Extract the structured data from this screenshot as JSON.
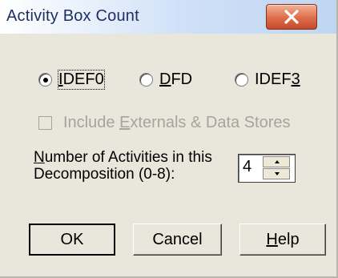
{
  "dialog": {
    "title": "Activity Box Count",
    "close_glyph": "✕"
  },
  "methods": {
    "selected": "IDEF0",
    "options": [
      {
        "pre": "",
        "mnemonic": "I",
        "post": "DEF0"
      },
      {
        "pre": "",
        "mnemonic": "D",
        "post": "FD"
      },
      {
        "pre": "IDEF",
        "mnemonic": "3",
        "post": ""
      }
    ]
  },
  "include_externals": {
    "pre": "Include ",
    "mnemonic": "E",
    "post": "xternals & Data Stores",
    "checked": false,
    "enabled": false
  },
  "activities": {
    "label_line1_mnemonic": "N",
    "label_line1_rest": "umber of Activities in this",
    "label_line2": "Decomposition (0-8):",
    "value": "4"
  },
  "buttons": {
    "ok": "OK",
    "cancel": "Cancel",
    "help_mnemonic": "H",
    "help_rest": "elp"
  },
  "colors": {
    "face": "#e9e6dc",
    "title_text": "#1f2f63",
    "close_button": "#de6d4b",
    "disabled_text": "#a7a49c"
  }
}
